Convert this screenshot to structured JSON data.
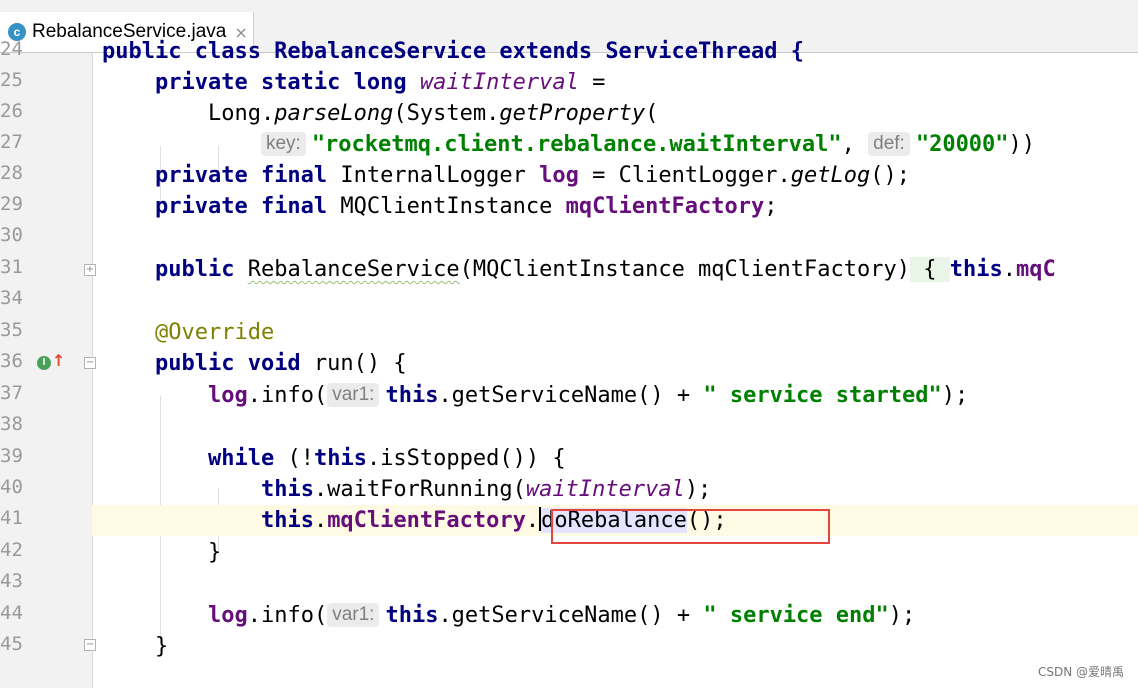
{
  "tab": {
    "icon_letter": "c",
    "filename": "RebalanceService.java",
    "close": "×"
  },
  "gutter_marks": {
    "override_icon": "I",
    "override_arrow": "↑",
    "collapsed": "+",
    "expanded": "−"
  },
  "code": {
    "l24": {
      "n": "24",
      "t": "public class RebalanceService extends ServiceThread {"
    },
    "l25": {
      "n": "25",
      "kw1": "private static long",
      "field": "waitInterval",
      "rest": " ="
    },
    "l26": {
      "n": "26",
      "a": "Long.",
      "m": "parseLong",
      "b": "(System.",
      "m2": "getProperty",
      "c": "("
    },
    "l27": {
      "n": "27",
      "hint1": "key:",
      "str1": "\"rocketmq.client.rebalance.waitInterval\"",
      "sep": ", ",
      "hint2": "def:",
      "str2": "\"20000\"",
      "end": "))"
    },
    "l28": {
      "n": "28",
      "kw": "private final",
      "type": "InternalLogger",
      "field": "log",
      "a": " = ClientLogger.",
      "m": "getLog",
      "end": "();"
    },
    "l29": {
      "n": "29",
      "kw": "private final",
      "type": "MQClientInstance",
      "field": "mqClientFactory",
      "end": ";"
    },
    "l30": {
      "n": "30"
    },
    "l31": {
      "n": "31",
      "kw": "public",
      "name": "RebalanceService",
      "params": "(MQClientInstance mqClientFactory)",
      "brace": " { ",
      "kw2": "this",
      "dot": ".",
      "field": "mqC"
    },
    "l34": {
      "n": "34"
    },
    "l35": {
      "n": "35",
      "ann": "@Override"
    },
    "l36": {
      "n": "36",
      "kw": "public void",
      "rest": " run() {"
    },
    "l37": {
      "n": "37",
      "field": "log",
      "a": ".info(",
      "hint": "var1:",
      "kw": "this",
      "b": ".getServiceName() + ",
      "str": "\" service started\"",
      "end": ");"
    },
    "l38": {
      "n": "38"
    },
    "l39": {
      "n": "39",
      "kw": "while",
      "a": " (!",
      "kw2": "this",
      "b": ".isStopped()) {"
    },
    "l40": {
      "n": "40",
      "kw": "this",
      "a": ".waitForRunning(",
      "field": "waitInterval",
      "end": ");"
    },
    "l41": {
      "n": "41",
      "kw": "this",
      "dot": ".",
      "field": "mqClientFactory",
      "dot2": ".",
      "m": "doRebalance",
      "end": "();"
    },
    "l42": {
      "n": "42",
      "t": "}"
    },
    "l43": {
      "n": "43"
    },
    "l44": {
      "n": "44",
      "field": "log",
      "a": ".info(",
      "hint": "var1:",
      "kw": "this",
      "b": ".getServiceName() + ",
      "str": "\" service end\"",
      "end": ");"
    },
    "l45": {
      "n": "45",
      "t": "}"
    }
  },
  "watermark": "CSDN @爱晴禹",
  "colors": {
    "keyword": "#000080",
    "field": "#660e7a",
    "string": "#008000",
    "annotation": "#808000",
    "highlight_box": "#e5453d"
  }
}
